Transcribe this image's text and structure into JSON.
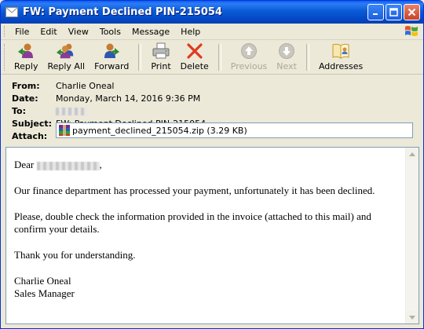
{
  "window": {
    "title": "FW: Payment Declined PIN-215054",
    "controls": [
      "minimize",
      "maximize",
      "close"
    ]
  },
  "menu": {
    "items": [
      "File",
      "Edit",
      "View",
      "Tools",
      "Message",
      "Help"
    ]
  },
  "toolbar": {
    "buttons": [
      {
        "label": "Reply",
        "icon": "reply-icon",
        "enabled": true
      },
      {
        "label": "Reply All",
        "icon": "reply-all-icon",
        "enabled": true
      },
      {
        "label": "Forward",
        "icon": "forward-icon",
        "enabled": true
      },
      {
        "label": "Print",
        "icon": "printer-icon",
        "enabled": true
      },
      {
        "label": "Delete",
        "icon": "delete-x-icon",
        "enabled": true
      },
      {
        "label": "Previous",
        "icon": "up-arrow-icon",
        "enabled": false
      },
      {
        "label": "Next",
        "icon": "down-arrow-icon",
        "enabled": false
      },
      {
        "label": "Addresses",
        "icon": "address-book-icon",
        "enabled": true
      }
    ]
  },
  "header": {
    "from_label": "From:",
    "from_value": "Charlie Oneal",
    "date_label": "Date:",
    "date_value": "Monday, March 14, 2016 9:36 PM",
    "to_label": "To:",
    "subject_label": "Subject:",
    "subject_value": "FW: Payment Declined PIN-215054",
    "attach_label": "Attach:",
    "attach_value": "payment_declined_215054.zip (3.29 KB)"
  },
  "message": {
    "greeting": "Dear",
    "greeting_punct": ",",
    "para1": "Our finance department has processed your payment, unfortunately it has been declined.",
    "para2": "Please, double check the information provided in the invoice (attached to this mail) and confirm your details.",
    "para3": "Thank you for understanding.",
    "signature_name": "Charlie Oneal",
    "signature_title": "Sales Manager"
  },
  "colors": {
    "titlebar": "#0b5bd7",
    "chrome": "#ece9d8",
    "delete_red": "#e03a1e"
  }
}
